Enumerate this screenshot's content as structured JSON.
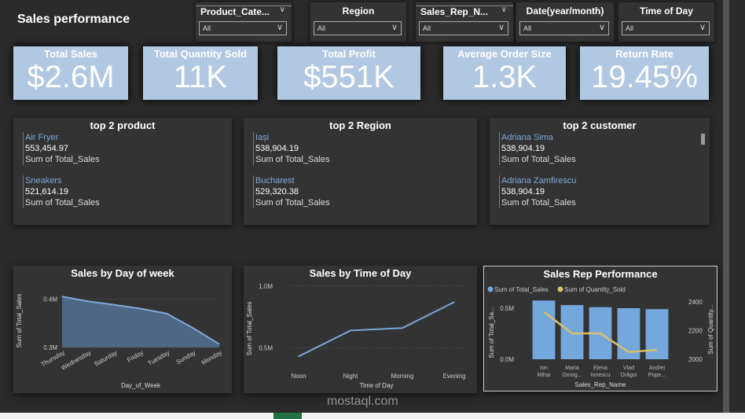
{
  "header": {
    "title": "Sales performance"
  },
  "slicers": [
    {
      "label": "Product_Cate...",
      "value": "All",
      "has_chevron": true
    },
    {
      "label": "Region",
      "value": "All"
    },
    {
      "label": "Sales_Rep_N...",
      "value": "All",
      "has_chevron": true
    },
    {
      "label": "Date(year/month)",
      "value": "All"
    },
    {
      "label": "Time of Day",
      "value": "All"
    }
  ],
  "kpis": [
    {
      "label": "Total Sales",
      "value": "$2.6M"
    },
    {
      "label": "Total Quantity Sold",
      "value": "11K"
    },
    {
      "label": "Total Profit",
      "value": "$551K"
    },
    {
      "label": "Average Order Size",
      "value": "1.3K"
    },
    {
      "label": "Return Rate",
      "value": "19.45%"
    }
  ],
  "cards": [
    {
      "title": "top 2 product",
      "items": [
        {
          "name": "Air Fryer",
          "value": "553,454.97",
          "measure": "Sum of Total_Sales"
        },
        {
          "name": "Sneakers",
          "value": "521,614.19",
          "measure": "Sum of Total_Sales"
        }
      ]
    },
    {
      "title": "top 2 Region",
      "items": [
        {
          "name": "Iași",
          "value": "538,904.19",
          "measure": "Sum of Total_Sales"
        },
        {
          "name": "Bucharest",
          "value": "529,320.38",
          "measure": "Sum of Total_Sales"
        }
      ]
    },
    {
      "title": "top 2 customer",
      "items": [
        {
          "name": "Adriana Sima",
          "value": "538,904.19",
          "measure": "Sum of Total_Sales"
        },
        {
          "name": "Adriana Zamfirescu",
          "value": "538,904.19",
          "measure": "Sum of Total_Sales"
        }
      ]
    }
  ],
  "watermark": {
    "text": "mostaql.com"
  },
  "colors": {
    "kpi": "#b0c8e2",
    "line": "#7fa8d8",
    "area": "#4e6785",
    "bar": "#74a7dc",
    "qty": "#d8c06a"
  },
  "chart_data": [
    {
      "type": "area",
      "title": "Sales by Day of week",
      "xlabel": "Day_of_Week",
      "ylabel": "Sum of Total_Sales",
      "categories": [
        "Thursday",
        "Wednesday",
        "Saturday",
        "Friday",
        "Tuesday",
        "Sunday",
        "Monday"
      ],
      "values": [
        0.405,
        0.395,
        0.388,
        0.38,
        0.37,
        0.34,
        0.307
      ],
      "ylim": [
        0.3,
        0.42
      ],
      "yticks": [
        {
          "v": 0.3,
          "label": "0.3M"
        },
        {
          "v": 0.4,
          "label": "0.4M"
        }
      ]
    },
    {
      "type": "line",
      "title": "Sales by Time of Day",
      "xlabel": "Time of Day",
      "ylabel": "Sum of Total_Sales",
      "categories": [
        "Noon",
        "Night",
        "Morning",
        "Evening"
      ],
      "values": [
        0.43,
        0.64,
        0.66,
        0.87
      ],
      "ylim": [
        0.35,
        1.05
      ],
      "yticks": [
        {
          "v": 0.5,
          "label": "0.5M"
        },
        {
          "v": 1.0,
          "label": "1.0M"
        }
      ]
    },
    {
      "type": "bar",
      "title": "Sales Rep Performance",
      "xlabel": "Sales_Rep_Name",
      "ylabel": "Sum of Total_Sa...",
      "y2label": "Sum of Quantity...",
      "legend": [
        "Sum of Total_Sales",
        "Sum of Quantity_Sold"
      ],
      "legend_position": "top-left",
      "categories": [
        [
          "Ion",
          "Mihai"
        ],
        [
          "Maria",
          "Georg..."
        ],
        [
          "Elena",
          "Ionescu"
        ],
        [
          "Vlad",
          "Drăgoi"
        ],
        [
          "Andrei",
          "Pope..."
        ]
      ],
      "series": [
        {
          "name": "Sum of Total_Sales",
          "values": [
            0.575,
            0.53,
            0.51,
            0.5,
            0.49
          ]
        },
        {
          "name": "Sum of Quantity_Sold",
          "values": [
            2330,
            2180,
            2180,
            2050,
            2065
          ]
        }
      ],
      "ylim": [
        0,
        0.6
      ],
      "yticks": [
        {
          "v": 0,
          "label": "0.0M"
        },
        {
          "v": 0.5,
          "label": "0.5M"
        }
      ],
      "y2lim": [
        2000,
        2400
      ],
      "y2ticks": [
        {
          "v": 2000,
          "label": "2000"
        },
        {
          "v": 2200,
          "label": "2200"
        },
        {
          "v": 2400,
          "label": "2400"
        }
      ]
    }
  ]
}
